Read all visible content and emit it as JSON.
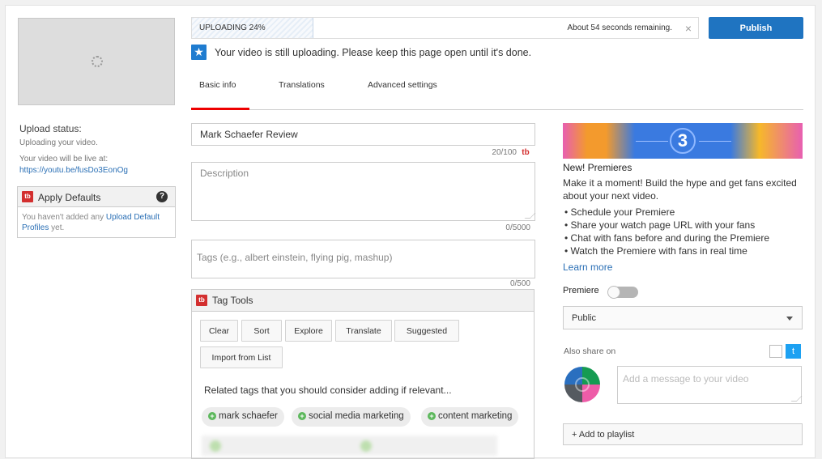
{
  "left_panel": {
    "upload_status_title": "Upload status:",
    "upload_status_text": "Uploading your video.",
    "live_at_label": "Your video will be live at:",
    "live_link": "https://youtu.be/fusDo3EonOg",
    "apply_defaults": {
      "logo": "tb",
      "title": "Apply Defaults",
      "help": "?",
      "body_prefix": "You haven't added any ",
      "body_link": "Upload Default Profiles",
      "body_suffix": " yet."
    }
  },
  "upload": {
    "label": "UPLOADING 24%",
    "progress_percent": 24,
    "remaining": "About 54 seconds remaining.",
    "close": "×",
    "publish_label": "Publish",
    "notice_icon": "★",
    "notice": "Your video is still uploading. Please keep this page open until it's done."
  },
  "tabs": [
    {
      "label": "Basic info",
      "active": true
    },
    {
      "label": "Translations",
      "active": false
    },
    {
      "label": "Advanced settings",
      "active": false
    }
  ],
  "form": {
    "title_value": "Mark Schaefer Review",
    "title_count": "20/100",
    "title_logo": "tb",
    "description_placeholder": "Description",
    "description_count": "0/5000",
    "tags_placeholder": "Tags (e.g., albert einstein, flying pig, mashup)",
    "tags_count": "0/500"
  },
  "tag_tools": {
    "logo": "tb",
    "title": "Tag Tools",
    "buttons": [
      "Clear",
      "Sort",
      "Explore",
      "Translate",
      "Suggested",
      "Import from List"
    ],
    "related_label": "Related tags that you should consider adding if relevant...",
    "related_tags": [
      "mark schaefer",
      "social media marketing",
      "content marketing"
    ],
    "plus": "+"
  },
  "premieres": {
    "banner_number": "3",
    "title": "New! Premieres",
    "body": "Make it a moment! Build the hype and get fans excited about your next video.",
    "bullets": [
      "Schedule your Premiere",
      "Share your watch page URL with your fans",
      "Chat with fans before and during the Premiere",
      "Watch the Premiere with fans in real time"
    ],
    "learn_more": "Learn more"
  },
  "settings": {
    "premiere_label": "Premiere",
    "premiere_enabled": false,
    "privacy_value": "Public",
    "share_label": "Also share on",
    "twitter_icon": "t",
    "message_placeholder": "Add a message to your video",
    "add_playlist": "+ Add to playlist"
  }
}
